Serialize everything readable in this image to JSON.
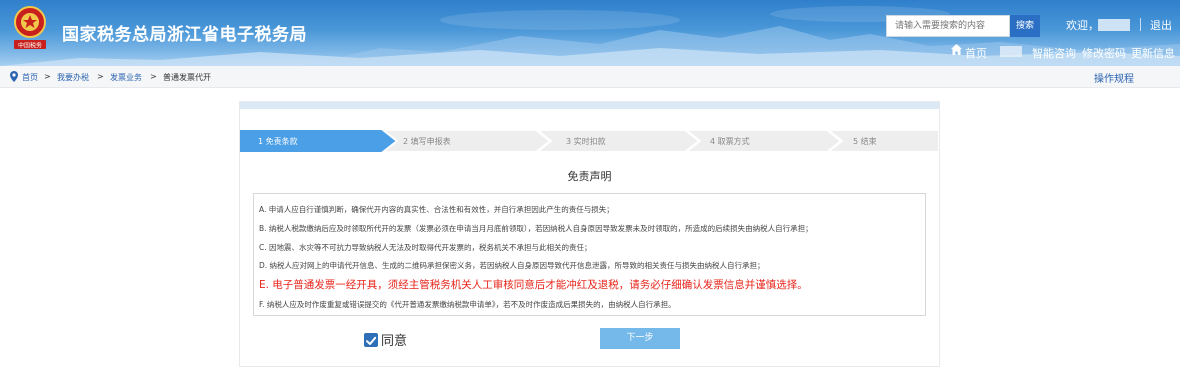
{
  "header": {
    "title": "国家税务总局浙江省电子税务局",
    "logo_text": "中国税务",
    "search": {
      "placeholder": "请输入需要搜索的内容",
      "button": "搜索"
    },
    "welcome": "欢迎，",
    "logout": "退出",
    "nav": {
      "home": "首页",
      "items": [
        "智能咨询",
        "修改密码",
        "更新信息"
      ]
    }
  },
  "breadcrumb": {
    "items": [
      "首页",
      "我要办税",
      "发票业务",
      "普通发票代开"
    ],
    "separator": ">",
    "ops_link": "操作规程"
  },
  "steps": [
    "1 免责条款",
    "2 填写申报表",
    "3 实时扣款",
    "4 取票方式",
    "5 结束"
  ],
  "active_step": 0,
  "disclaimer": {
    "title": "免责声明",
    "clauses": [
      "A. 申请人应自行谨慎判断，确保代开内容的真实性、合法性和有效性，并自行承担因此产生的责任与损失；",
      "B. 纳税人税款缴纳后应及时领取所代开的发票（发票必须在申请当月月底前领取），若因纳税人自身原因导致发票未及时领取的，所造成的后续损失由纳税人自行承担；",
      "C. 因地震、水灾等不可抗力导致纳税人无法及时取得代开发票的，税务机关不承担与此相关的责任；",
      "D. 纳税人应对网上的申请代开信息、生成的二维码承担保密义务，若因纳税人自身原因导致代开信息泄露，所导致的相关责任与损失由纳税人自行承担；",
      "E. 电子普通发票一经开具，须经主管税务机关人工审核同意后才能冲红及退税，请务必仔细确认发票信息并谨慎选择。",
      "F. 纳税人应及时作废重复或错误提交的《代开普通发票缴纳税款申请单》，若不及时作废造成后果损失的，由纳税人自行承担。"
    ],
    "warning_index": 4
  },
  "agree": {
    "label": "同意",
    "checked": true
  },
  "next_button": "下一步",
  "colors": {
    "header_blue": "#2f7fcc",
    "active_step": "#4a9fe6",
    "inactive_step": "#eeeeee",
    "warning": "#e8241b",
    "link": "#2c64b0",
    "next_button": "#74b9ea"
  }
}
